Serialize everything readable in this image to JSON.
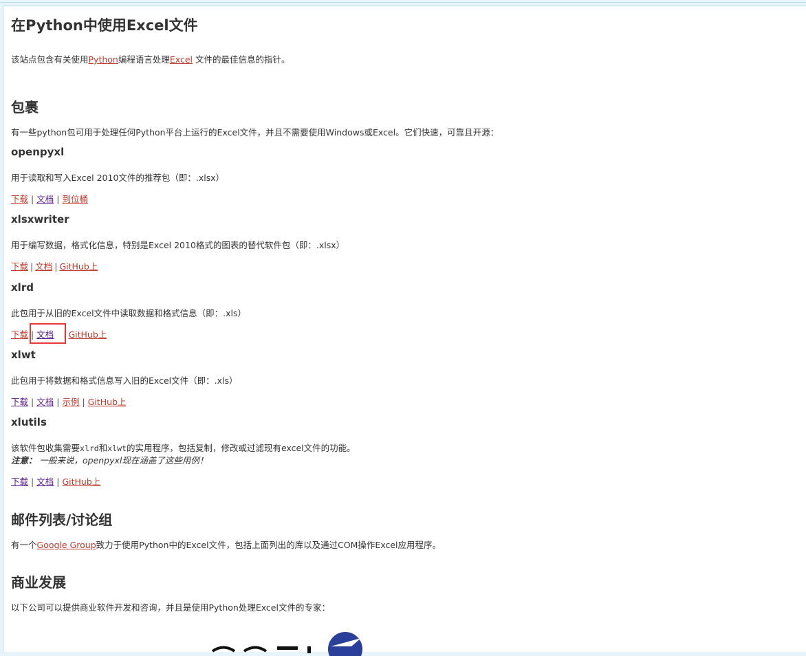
{
  "title": "在Python中使用Excel文件",
  "intro": {
    "before": "该站点包含有关使用",
    "link1": "Python",
    "middle": "编程语言处理",
    "link2": "Excel",
    "after": " 文件的最佳信息的指针。"
  },
  "packages": {
    "heading": "包裹",
    "description": "有一些python包可用于处理任何Python平台上运行的Excel文件，并且不需要使用Windows或Excel。它们快速，可靠且开源：",
    "items": [
      {
        "name": "openpyxl",
        "desc": "用于读取和写入Excel 2010文件的推荐包（即：.xlsx）",
        "links": [
          "下载",
          "文档",
          "到位桶"
        ]
      },
      {
        "name": "xlsxwriter",
        "desc": "用于编写数据，格式化信息，特别是Excel 2010格式的图表的替代软件包（即：.xlsx）",
        "links": [
          "下载",
          "文档",
          "GitHub上"
        ]
      },
      {
        "name": "xlrd",
        "desc": "此包用于从旧的Excel文件中读取数据和格式信息（即：.xls）",
        "links": [
          "下载",
          "文档",
          "GitHub上"
        ]
      },
      {
        "name": "xlwt",
        "desc": "此包用于将数据和格式信息写入旧的Excel文件（即：.xls）",
        "links": [
          "下载",
          "文档",
          "示例",
          "GitHub上"
        ]
      },
      {
        "name": "xlutils",
        "desc_before": "该软件包收集需要",
        "desc_code1": "xlrd",
        "desc_and": "和",
        "desc_code2": "xlwt",
        "desc_after": "的实用程序，包括复制，修改或过滤现有excel文件的功能。",
        "note_label": "注意：",
        "note_text": " 一般来说，openpyxl现在涵盖了这些用例！",
        "links": [
          "下载",
          "文档",
          "GitHub上"
        ]
      }
    ]
  },
  "mailing": {
    "heading": "邮件列表/讨论组",
    "before": "有一个",
    "link": "Google Group",
    "after": "致力于使用Python中的Excel文件，包括上面列出的库以及通过COM操作Excel应用程序。"
  },
  "commercial": {
    "heading": "商业发展",
    "description": "以下公司可以提供商业软件开发和咨询，并且是使用Python处理Excel文件的专家："
  },
  "colors": {
    "link_red": "#c0392b",
    "link_visited": "#551a8b",
    "highlight": "#e53935",
    "text": "#333333"
  }
}
